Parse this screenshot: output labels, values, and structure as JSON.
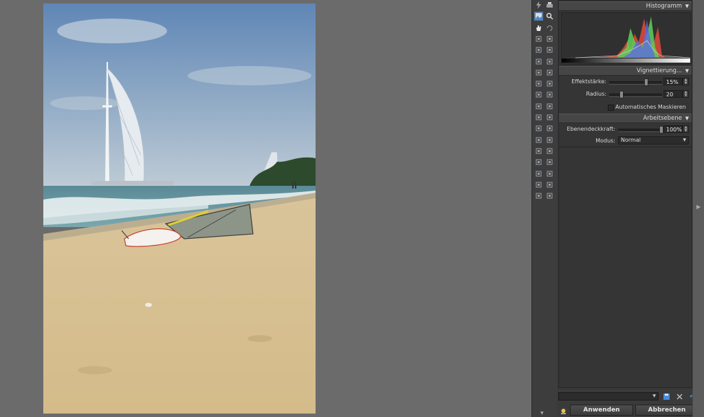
{
  "photo": {
    "alt_subject": "beach"
  },
  "panel": {
    "histogram": {
      "title": "Histogramm"
    },
    "vignette": {
      "title": "Vignettierung...",
      "strength_label": "Effektstärke:",
      "strength_value": "15%",
      "strength_fraction": 0.15,
      "radius_label": "Radius:",
      "radius_value": "20",
      "radius_fraction": 0.2,
      "auto_mask_label": "Automatisches Maskieren",
      "auto_mask_checked": false
    },
    "layer": {
      "title": "Arbeitsebene",
      "opacity_label": "Ebenendeckkraft:",
      "opacity_value": "100%",
      "opacity_fraction": 1.0,
      "mode_label": "Modus:",
      "mode_value": "Normal"
    }
  },
  "footer": {
    "preset_value": "",
    "apply_label": "Anwenden",
    "cancel_label": "Abbrechen"
  },
  "colors": {
    "workspace": "#6b6b6b",
    "panel": "#353535",
    "accent": "#5a7ea8",
    "hist_red": "#e04a3a",
    "hist_green": "#5fd05a",
    "hist_blue": "#5a6ee0"
  },
  "tools": [
    "lightning-icon",
    "print-icon",
    "image-icon",
    "zoom-icon",
    "hand-icon",
    "rotate-icon",
    "grid-icon",
    "calc-icon",
    "layers-icon",
    "crop-icon",
    "frame-icon",
    "text-frame-icon",
    "box-icon",
    "link-icon",
    "stamp-icon",
    "eraser-icon",
    "brush-icon",
    "wand-icon",
    "pencil-icon",
    "dropper-icon",
    "smudge-icon",
    "marquee-icon",
    "lasso-icon",
    "poly-lasso-icon",
    "free-select-icon",
    "color-select-icon",
    "magic-wand-icon",
    "pen-icon",
    "clone-icon",
    "transform-icon",
    "circle-icon",
    "blend-icon",
    "line-icon",
    "image-box-icon",
    "film-icon",
    "gallery-icon"
  ]
}
